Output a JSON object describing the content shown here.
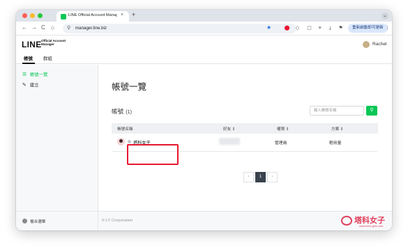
{
  "browser": {
    "tab_title": "LINE Official Account Manag",
    "tab_close": "×",
    "new_tab": "+",
    "tab_menu": "⌄",
    "nav": {
      "back": "←",
      "forward": "→",
      "reload": "C",
      "home": "⌂"
    },
    "omnibox_icon": "⚲",
    "url": "manager.line.biz",
    "bookmark": "★",
    "extensions": [
      "⬤",
      "◇",
      "▢",
      "≡",
      "⤓",
      "⚑"
    ],
    "update_button": "重新啟動即可更新",
    "more": "⋮"
  },
  "app": {
    "logo": "LINE",
    "logo_sub": "Official Account Manager",
    "username": "Rachel",
    "nav_tabs": [
      "帳號",
      "群組"
    ]
  },
  "sidebar": {
    "items": [
      {
        "icon": "☰",
        "label": "帳號一覽"
      },
      {
        "icon": "✎",
        "label": "建立"
      }
    ],
    "footer": "複合選單"
  },
  "main": {
    "page_title": "帳號一覽",
    "section_title": "帳號",
    "section_count": "(1)",
    "search_placeholder": "輸入帳號名稱",
    "search_icon": "⚲",
    "table": {
      "headers": [
        "帳號名稱",
        "好友 ⇕",
        "權限 ⇕",
        "方案 ⇕"
      ],
      "rows": [
        {
          "name": "塔科女子",
          "role": "管理員",
          "plan": "輕用量"
        }
      ]
    },
    "pager": {
      "prev": "‹",
      "current": "1",
      "next": "›"
    }
  },
  "footer": {
    "copyright": "© LY Corporation",
    "watermark": "塔科女子",
    "watermark_url": "www.tech-girlz.com"
  },
  "colors": {
    "accent": "#06c755",
    "highlight": "#e8162f",
    "watermark": "#e0405b"
  }
}
